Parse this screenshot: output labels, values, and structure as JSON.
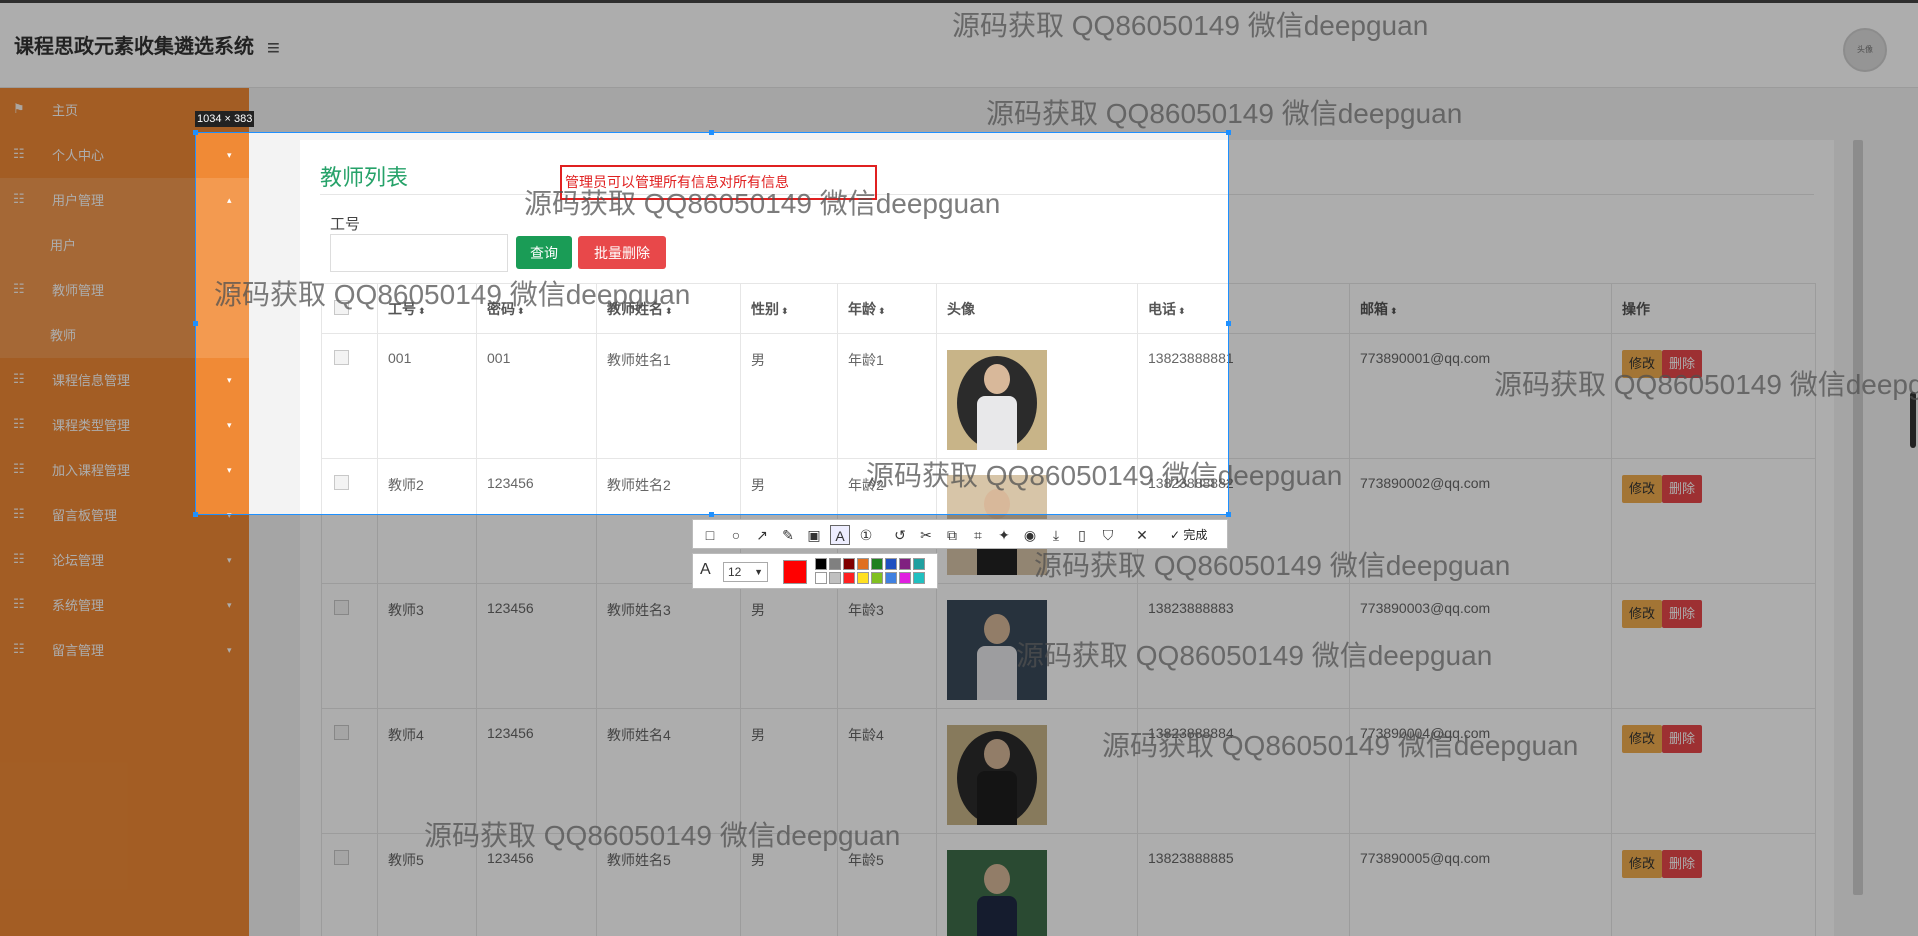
{
  "app": {
    "title": "课程思政元素收集遴选系统",
    "menu_icon": "hamburger-icon",
    "avatar_text": "头像"
  },
  "sidebar": {
    "items": [
      {
        "label": "主页",
        "icon": "flag-icon",
        "arrow": ""
      },
      {
        "label": "个人中心",
        "icon": "grid-icon",
        "arrow": "▾"
      },
      {
        "label": "用户管理",
        "icon": "grid-icon",
        "arrow": "▴"
      },
      {
        "label": "用户",
        "icon": "",
        "arrow": ""
      },
      {
        "label": "教师管理",
        "icon": "grid-icon",
        "arrow": "▴"
      },
      {
        "label": "教师",
        "icon": "",
        "arrow": ""
      },
      {
        "label": "课程信息管理",
        "icon": "grid-icon",
        "arrow": "▾"
      },
      {
        "label": "课程类型管理",
        "icon": "grid-icon",
        "arrow": "▾"
      },
      {
        "label": "加入课程管理",
        "icon": "grid-icon",
        "arrow": "▾"
      },
      {
        "label": "留言板管理",
        "icon": "grid-icon",
        "arrow": "▾"
      },
      {
        "label": "论坛管理",
        "icon": "grid-icon",
        "arrow": "▾"
      },
      {
        "label": "系统管理",
        "icon": "grid-icon",
        "arrow": "▾"
      },
      {
        "label": "留言管理",
        "icon": "grid-icon",
        "arrow": "▾"
      }
    ]
  },
  "panel": {
    "title": "教师列表",
    "search_label": "工号",
    "search_value": "",
    "query_button": "查询",
    "batch_delete_button": "批量删除"
  },
  "table": {
    "columns": [
      "工号",
      "密码",
      "教师姓名",
      "性别",
      "年龄",
      "头像",
      "电话",
      "邮箱",
      "操作"
    ],
    "sort_icon": "⬍",
    "rows": [
      {
        "id": "001",
        "pwd": "001",
        "name": "教师姓名1",
        "gender": "男",
        "age": "年龄1",
        "phone": "13823888881",
        "email": "773890001@qq.com"
      },
      {
        "id": "教师2",
        "pwd": "123456",
        "name": "教师姓名2",
        "gender": "男",
        "age": "年龄2",
        "phone": "13823888882",
        "email": "773890002@qq.com"
      },
      {
        "id": "教师3",
        "pwd": "123456",
        "name": "教师姓名3",
        "gender": "男",
        "age": "年龄3",
        "phone": "13823888883",
        "email": "773890003@qq.com"
      },
      {
        "id": "教师4",
        "pwd": "123456",
        "name": "教师姓名4",
        "gender": "男",
        "age": "年龄4",
        "phone": "13823888884",
        "email": "773890004@qq.com"
      },
      {
        "id": "教师5",
        "pwd": "123456",
        "name": "教师姓名5",
        "gender": "男",
        "age": "年龄5",
        "phone": "13823888885",
        "email": "773890005@qq.com"
      }
    ],
    "edit_label": "修改",
    "delete_label": "删除"
  },
  "screenshot_tool": {
    "size_label": "1034 × 383",
    "annotation_text": "管理员可以管理所有信息对所有信息",
    "done_label": "完成",
    "font_size": "12",
    "current_color": "#ff0000",
    "tools": [
      "rectangle-icon",
      "ellipse-icon",
      "arrow-icon",
      "pen-icon",
      "mosaic-icon",
      "text-icon",
      "number-icon",
      "undo-icon",
      "cut-icon",
      "copy-icon",
      "ocr-icon",
      "pin-icon",
      "record-icon",
      "download-icon",
      "save-icon",
      "bookmark-icon",
      "close-icon",
      "check-icon"
    ],
    "palette": [
      "#000000",
      "#808080",
      "#800000",
      "#e07020",
      "#208020",
      "#2050c0",
      "#802080",
      "#20a0a0",
      "#ffffff",
      "#c0c0c0",
      "#ff2020",
      "#ffe020",
      "#80c020",
      "#4080e0",
      "#e020e0",
      "#20c0c0"
    ]
  },
  "watermark": "源码获取 QQ86050149 微信deepguan"
}
